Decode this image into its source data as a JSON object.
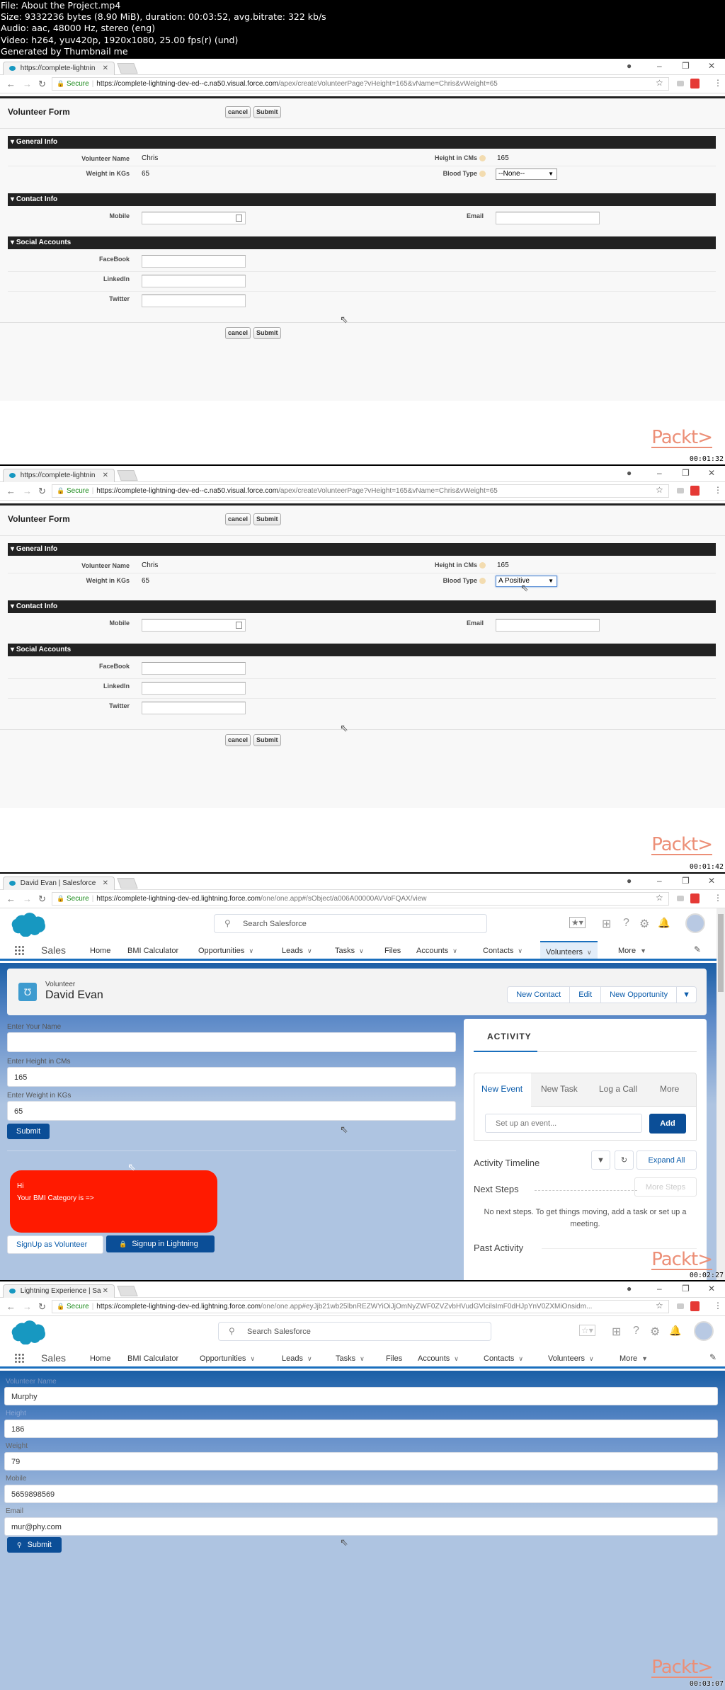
{
  "file_info": {
    "line1": "File: About the Project.mp4",
    "line2": "Size: 9332236 bytes (8.90 MiB), duration: 00:03:52, avg.bitrate: 322 kb/s",
    "line3": "Audio: aac, 48000 Hz, stereo (eng)",
    "line4": "Video: h264, yuv420p, 1920x1080, 25.00 fps(r) (und)",
    "line5": "Generated by Thumbnail me"
  },
  "watermark": "Packt>",
  "frames": [
    {
      "timestamp": "00:01:32",
      "browser": {
        "tab_title": "https://complete-lightnin",
        "secure_label": "Secure",
        "url_host": "https://complete-lightning-dev-ed--c.na50.visual.force.com",
        "url_path": "/apex/createVolunteerPage?vHeight=165&vName=Chris&vWeight=65"
      },
      "form": {
        "title": "Volunteer Form",
        "cancel_label": "cancel",
        "submit_label": "Submit",
        "sections": {
          "general": "General Info",
          "contact": "Contact Info",
          "social": "Social Accounts"
        },
        "labels": {
          "volunteer_name": "Volunteer Name",
          "weight": "Weight in KGs",
          "height": "Height in CMs",
          "blood_type": "Blood Type",
          "mobile": "Mobile",
          "email": "Email",
          "facebook": "FaceBook",
          "linkedin": "LinkedIn",
          "twitter": "Twitter"
        },
        "values": {
          "volunteer_name": "Chris",
          "weight": "65",
          "height": "165",
          "blood_type": "--None--",
          "mobile": "",
          "email": "",
          "facebook": "",
          "linkedin": "",
          "twitter": ""
        }
      }
    },
    {
      "timestamp": "00:01:42",
      "browser": {
        "tab_title": "https://complete-lightnin",
        "secure_label": "Secure",
        "url_host": "https://complete-lightning-dev-ed--c.na50.visual.force.com",
        "url_path": "/apex/createVolunteerPage?vHeight=165&vName=Chris&vWeight=65"
      },
      "form": {
        "title": "Volunteer Form",
        "cancel_label": "cancel",
        "submit_label": "Submit",
        "sections": {
          "general": "General Info",
          "contact": "Contact Info",
          "social": "Social Accounts"
        },
        "labels": {
          "volunteer_name": "Volunteer Name",
          "weight": "Weight in KGs",
          "height": "Height in CMs",
          "blood_type": "Blood Type",
          "mobile": "Mobile",
          "email": "Email",
          "facebook": "FaceBook",
          "linkedin": "LinkedIn",
          "twitter": "Twitter"
        },
        "values": {
          "volunteer_name": "Chris",
          "weight": "65",
          "height": "165",
          "blood_type": "A Positive",
          "mobile": "",
          "email": "",
          "facebook": "",
          "linkedin": "",
          "twitter": ""
        }
      }
    },
    {
      "timestamp": "00:02:27",
      "browser": {
        "tab_title": "David Evan | Salesforce",
        "secure_label": "Secure",
        "url_host": "https://complete-lightning-dev-ed.lightning.force.com",
        "url_path": "/one/one.app#/sObject/a006A00000AVVoFQAX/view"
      },
      "sf": {
        "search_placeholder": "Search Salesforce",
        "app_name": "Sales",
        "nav": [
          "Home",
          "BMI Calculator",
          "Opportunities",
          "Leads",
          "Tasks",
          "Files",
          "Accounts",
          "Contacts",
          "Volunteers",
          "More"
        ],
        "active_nav": "Volunteers"
      },
      "record": {
        "type": "Volunteer",
        "name": "David Evan",
        "actions": [
          "New Contact",
          "Edit",
          "New Opportunity"
        ]
      },
      "bmi_form": {
        "name_label": "Enter Your Name",
        "name_value": "",
        "height_label": "Enter Height in CMs",
        "height_value": "165",
        "weight_label": "Enter Weight in KGs",
        "weight_value": "65",
        "submit_label": "Submit",
        "result_line1": "Hi",
        "result_line2": "Your BMI Category is =>",
        "signup_volunteer_label": "SignUp as Volunteer",
        "signup_lightning_label": "Signup in Lightning",
        "result_color": "#ff1a00"
      },
      "activity": {
        "title": "ACTIVITY",
        "tabs": [
          "New Event",
          "New Task",
          "Log a Call",
          "More"
        ],
        "active_tab": "New Event",
        "event_placeholder": "Set up an event...",
        "add_label": "Add",
        "timeline_title": "Activity Timeline",
        "expand_all_label": "Expand All",
        "next_steps_title": "Next Steps",
        "more_steps_label": "More Steps",
        "no_next_steps": "No next steps. To get things moving, add a task or set up a meeting.",
        "past_activity_title": "Past Activity"
      }
    },
    {
      "timestamp": "00:03:07",
      "browser": {
        "tab_title": "Lightning Experience | Sa",
        "secure_label": "Secure",
        "url_host": "https://complete-lightning-dev-ed.lightning.force.com",
        "url_path": "/one/one.app#eyJjb21wb25lbnREZWYiOiJjOmNyZWF0ZVZvbHVudGVlcilsImF0dHJpYnV0ZXMiOnsidm..."
      },
      "sf": {
        "search_placeholder": "Search Salesforce",
        "app_name": "Sales",
        "nav": [
          "Home",
          "BMI Calculator",
          "Opportunities",
          "Leads",
          "Tasks",
          "Files",
          "Accounts",
          "Contacts",
          "Volunteers",
          "More"
        ]
      },
      "volunteer_form": {
        "name_label": "Volunteer Name",
        "name_value": "Murphy",
        "height_label": "Height",
        "height_value": "186",
        "weight_label": "Weight",
        "weight_value": "79",
        "mobile_label": "Mobile",
        "mobile_value": "5659898569",
        "email_label": "Email",
        "email_value": "mur@phy.com",
        "submit_label": "Submit"
      }
    }
  ]
}
